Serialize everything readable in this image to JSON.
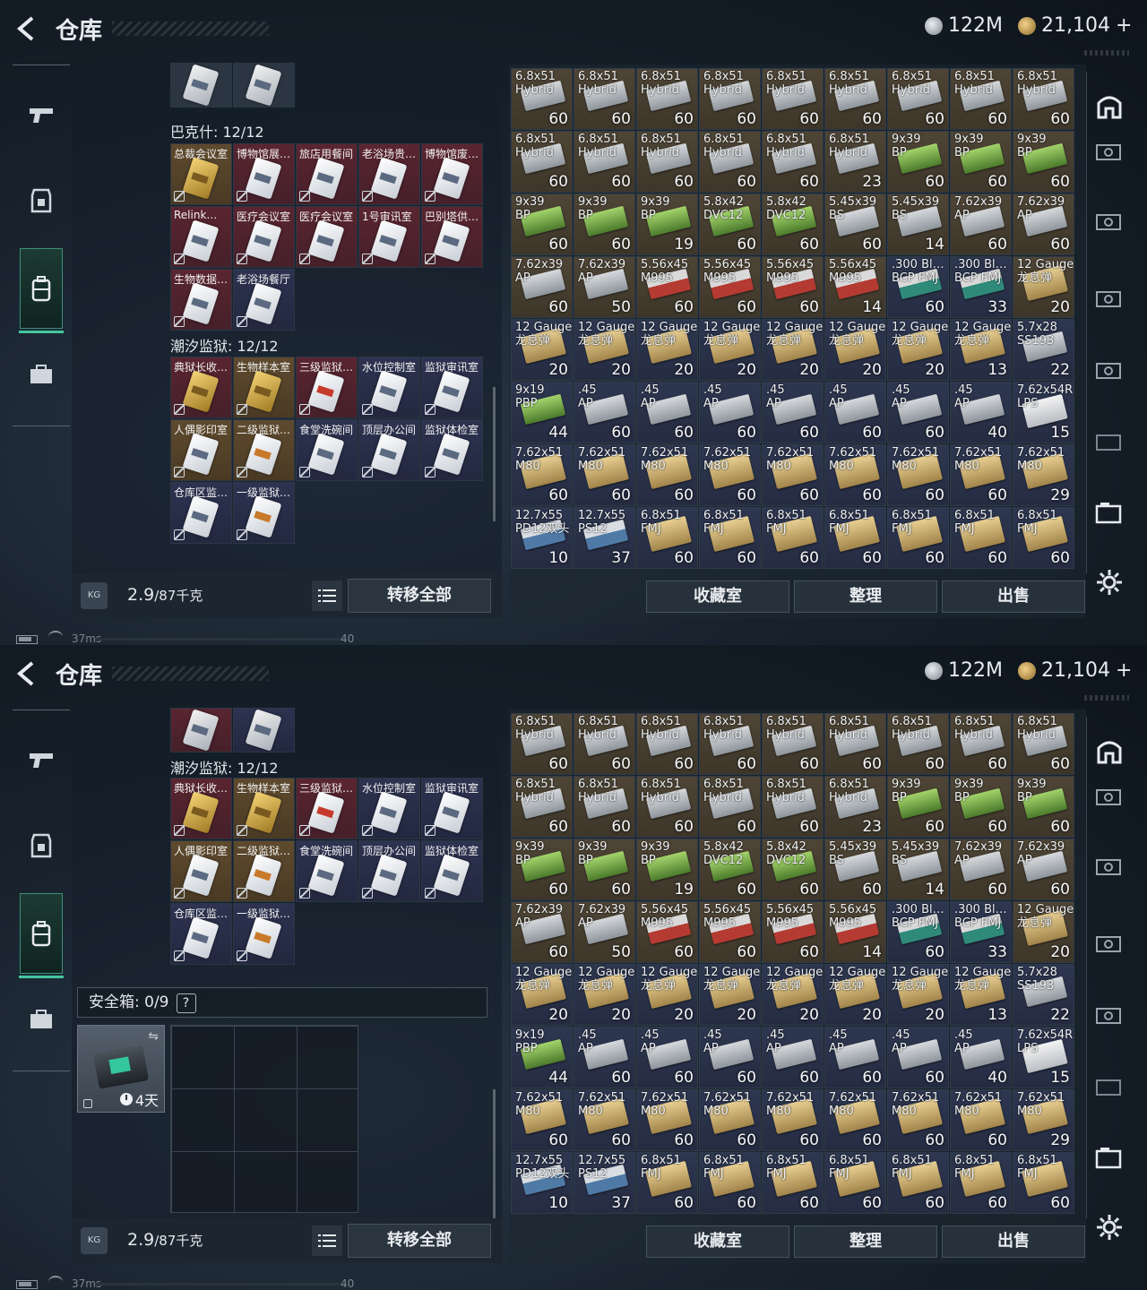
{
  "header": {
    "title": "仓库",
    "currency_silver": "122M",
    "currency_gold": "21,104",
    "gold_plus": "+"
  },
  "left": {
    "categories": {
      "bakeshi": "巴克什: 12/12",
      "chaoxi": "潮汐监狱: 12/12"
    },
    "bakeshi_cards": [
      "总裁会议室",
      "博物馆展…",
      "旅店用餐间",
      "老浴场贵…",
      "博物馆废…",
      "Relink…",
      "医疗会议室",
      "医疗会议室",
      "1号审讯室",
      "巴别塔供…",
      "生物数据…",
      "老浴场餐厅"
    ],
    "chaoxi_cards": [
      "典狱长收…",
      "生物样本室",
      "三级监狱…",
      "水位控制室",
      "监狱审讯室",
      "人偶影印室",
      "二级监狱…",
      "食堂洗碗间",
      "顶层办公间",
      "监狱体检室",
      "仓库区监…",
      "一级监狱…"
    ],
    "weight": "2.9",
    "weight_max": "/87千克",
    "kg_badge": "KG",
    "transfer_all": "转移全部"
  },
  "safebox": {
    "label": "安全箱: 0/9",
    "help": "?",
    "time_left": "4天"
  },
  "actions": {
    "collection": "收藏室",
    "sort": "整理",
    "sell": "出售"
  },
  "status": {
    "ping": "37ms",
    "fps": "40"
  },
  "ammo": [
    {
      "name": "6.8x51\nHybrid",
      "count": "60",
      "color": "gray",
      "bg": "brown"
    },
    {
      "name": "6.8x51\nHybrid",
      "count": "60",
      "color": "gray",
      "bg": "brown"
    },
    {
      "name": "6.8x51\nHybrid",
      "count": "60",
      "color": "gray",
      "bg": "brown"
    },
    {
      "name": "6.8x51\nHybrid",
      "count": "60",
      "color": "gray",
      "bg": "brown"
    },
    {
      "name": "6.8x51\nHybrid",
      "count": "60",
      "color": "gray",
      "bg": "brown"
    },
    {
      "name": "6.8x51\nHybrid",
      "count": "60",
      "color": "gray",
      "bg": "brown"
    },
    {
      "name": "6.8x51\nHybrid",
      "count": "60",
      "color": "gray",
      "bg": "brown"
    },
    {
      "name": "6.8x51\nHybrid",
      "count": "60",
      "color": "gray",
      "bg": "brown"
    },
    {
      "name": "6.8x51\nHybrid",
      "count": "60",
      "color": "gray",
      "bg": "brown"
    },
    {
      "name": "6.8x51\nHybrid",
      "count": "60",
      "color": "gray",
      "bg": "brown"
    },
    {
      "name": "6.8x51\nHybrid",
      "count": "60",
      "color": "gray",
      "bg": "brown"
    },
    {
      "name": "6.8x51\nHybrid",
      "count": "60",
      "color": "gray",
      "bg": "brown"
    },
    {
      "name": "6.8x51\nHybrid",
      "count": "60",
      "color": "gray",
      "bg": "brown"
    },
    {
      "name": "6.8x51\nHybrid",
      "count": "60",
      "color": "gray",
      "bg": "brown"
    },
    {
      "name": "6.8x51\nHybrid",
      "count": "23",
      "color": "gray",
      "bg": "brown"
    },
    {
      "name": "9x39\nBP",
      "count": "60",
      "color": "green",
      "bg": "brown"
    },
    {
      "name": "9x39\nBP",
      "count": "60",
      "color": "green",
      "bg": "brown"
    },
    {
      "name": "9x39\nBP",
      "count": "60",
      "color": "green",
      "bg": "brown"
    },
    {
      "name": "9x39\nBP",
      "count": "60",
      "color": "green",
      "bg": "brown"
    },
    {
      "name": "9x39\nBP",
      "count": "60",
      "color": "green",
      "bg": "brown"
    },
    {
      "name": "9x39\nBP",
      "count": "19",
      "color": "green",
      "bg": "brown"
    },
    {
      "name": "5.8x42\nDVC12",
      "count": "60",
      "color": "green",
      "bg": "brown"
    },
    {
      "name": "5.8x42\nDVC12",
      "count": "60",
      "color": "green",
      "bg": "brown"
    },
    {
      "name": "5.45x39\nBS",
      "count": "60",
      "color": "gray",
      "bg": "brown"
    },
    {
      "name": "5.45x39\nBS",
      "count": "14",
      "color": "gray",
      "bg": "brown"
    },
    {
      "name": "7.62x39\nAP",
      "count": "60",
      "color": "gray",
      "bg": "brown"
    },
    {
      "name": "7.62x39\nAP",
      "count": "60",
      "color": "gray",
      "bg": "brown"
    },
    {
      "name": "7.62x39\nAP",
      "count": "60",
      "color": "gray",
      "bg": "brown"
    },
    {
      "name": "7.62x39\nAP",
      "count": "50",
      "color": "gray",
      "bg": "brown"
    },
    {
      "name": "5.56x45\nM995",
      "count": "60",
      "color": "red",
      "bg": "brown"
    },
    {
      "name": "5.56x45\nM995",
      "count": "60",
      "color": "red",
      "bg": "brown"
    },
    {
      "name": "5.56x45\nM995",
      "count": "60",
      "color": "red",
      "bg": "brown"
    },
    {
      "name": "5.56x45\nM995",
      "count": "14",
      "color": "red",
      "bg": "brown"
    },
    {
      "name": ".300 Bl…\nBCP FMJ",
      "count": "60",
      "color": "teal",
      "bg": "blue"
    },
    {
      "name": ".300 Bl…\nBCP FMJ",
      "count": "33",
      "color": "teal",
      "bg": "blue"
    },
    {
      "name": "12 Gauge\n龙息弹",
      "count": "20",
      "color": "tan",
      "bg": "brown"
    },
    {
      "name": "12 Gauge\n龙息弹",
      "count": "20",
      "color": "tan",
      "bg": "blue"
    },
    {
      "name": "12 Gauge\n龙息弹",
      "count": "20",
      "color": "tan",
      "bg": "blue"
    },
    {
      "name": "12 Gauge\n龙息弹",
      "count": "20",
      "color": "tan",
      "bg": "blue"
    },
    {
      "name": "12 Gauge\n龙息弹",
      "count": "20",
      "color": "tan",
      "bg": "blue"
    },
    {
      "name": "12 Gauge\n龙息弹",
      "count": "20",
      "color": "tan",
      "bg": "blue"
    },
    {
      "name": "12 Gauge\n龙息弹",
      "count": "20",
      "color": "tan",
      "bg": "blue"
    },
    {
      "name": "12 Gauge\n龙息弹",
      "count": "20",
      "color": "tan",
      "bg": "blue"
    },
    {
      "name": "12 Gauge\n龙息弹",
      "count": "13",
      "color": "tan",
      "bg": "blue"
    },
    {
      "name": "5.7x28\nSS193",
      "count": "22",
      "color": "gray",
      "bg": "blue"
    },
    {
      "name": "9x19\nPBP",
      "count": "44",
      "color": "green",
      "bg": "blue"
    },
    {
      "name": ".45\nAP",
      "count": "60",
      "color": "gray",
      "bg": "blue"
    },
    {
      "name": ".45\nAP",
      "count": "60",
      "color": "gray",
      "bg": "blue"
    },
    {
      "name": ".45\nAP",
      "count": "60",
      "color": "gray",
      "bg": "blue"
    },
    {
      "name": ".45\nAP",
      "count": "60",
      "color": "gray",
      "bg": "blue"
    },
    {
      "name": ".45\nAP",
      "count": "60",
      "color": "gray",
      "bg": "blue"
    },
    {
      "name": ".45\nAP",
      "count": "60",
      "color": "gray",
      "bg": "blue"
    },
    {
      "name": ".45\nAP",
      "count": "40",
      "color": "gray",
      "bg": "blue"
    },
    {
      "name": "7.62x54R\nLPS",
      "count": "15",
      "color": "white",
      "bg": "blue"
    },
    {
      "name": "7.62x51\nM80",
      "count": "60",
      "color": "tan",
      "bg": "blue"
    },
    {
      "name": "7.62x51\nM80",
      "count": "60",
      "color": "tan",
      "bg": "blue"
    },
    {
      "name": "7.62x51\nM80",
      "count": "60",
      "color": "tan",
      "bg": "blue"
    },
    {
      "name": "7.62x51\nM80",
      "count": "60",
      "color": "tan",
      "bg": "blue"
    },
    {
      "name": "7.62x51\nM80",
      "count": "60",
      "color": "tan",
      "bg": "blue"
    },
    {
      "name": "7.62x51\nM80",
      "count": "60",
      "color": "tan",
      "bg": "blue"
    },
    {
      "name": "7.62x51\nM80",
      "count": "60",
      "color": "tan",
      "bg": "blue"
    },
    {
      "name": "7.62x51\nM80",
      "count": "60",
      "color": "tan",
      "bg": "blue"
    },
    {
      "name": "7.62x51\nM80",
      "count": "29",
      "color": "tan",
      "bg": "blue"
    },
    {
      "name": "12.7x55\nPD12双头",
      "count": "10",
      "color": "blueish",
      "bg": "blue"
    },
    {
      "name": "12.7x55\nPS12",
      "count": "37",
      "color": "blueish",
      "bg": "blue"
    },
    {
      "name": "6.8x51\nFMJ",
      "count": "60",
      "color": "tan",
      "bg": "blue"
    },
    {
      "name": "6.8x51\nFMJ",
      "count": "60",
      "color": "tan",
      "bg": "blue"
    },
    {
      "name": "6.8x51\nFMJ",
      "count": "60",
      "color": "tan",
      "bg": "blue"
    },
    {
      "name": "6.8x51\nFMJ",
      "count": "60",
      "color": "tan",
      "bg": "blue"
    },
    {
      "name": "6.8x51\nFMJ",
      "count": "60",
      "color": "tan",
      "bg": "blue"
    },
    {
      "name": "6.8x51\nFMJ",
      "count": "60",
      "color": "tan",
      "bg": "blue"
    },
    {
      "name": "6.8x51\nFMJ",
      "count": "60",
      "color": "tan",
      "bg": "blue"
    }
  ]
}
